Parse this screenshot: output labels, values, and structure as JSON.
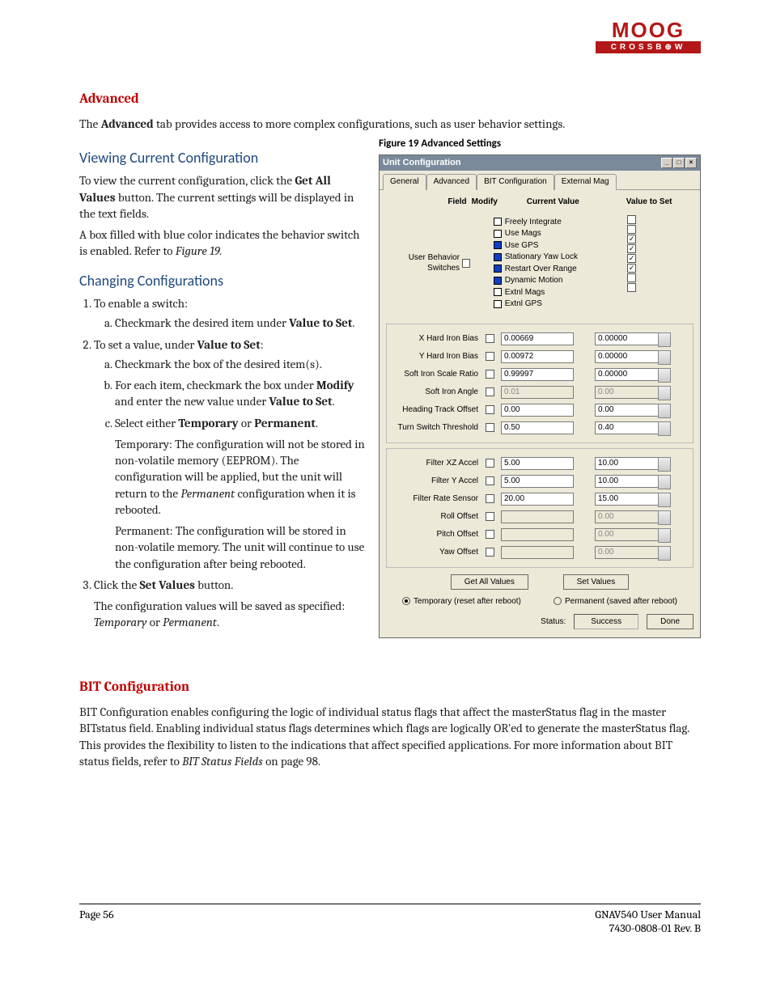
{
  "logo": {
    "top": "MOOG",
    "bottom": "CROSSB⊕W"
  },
  "sec1_title": "Advanced",
  "sec1_intro_a": "The ",
  "sec1_intro_b": "Advanced",
  "sec1_intro_c": " tab provides access to more complex configurations, such as user behavior settings.",
  "sec2_title": "Viewing Current Configuration",
  "sec2_p1_a": "To view the current configuration, click the ",
  "sec2_p1_b": "Get All Values",
  "sec2_p1_c": " button.  The current settings will be displayed in the text fields.",
  "sec2_p2_a": "A box filled with blue color indicates the behavior switch is enabled. Refer to ",
  "sec2_p2_b": "Figure 19.",
  "sec3_title": "Changing Configurations",
  "sec3_li1": "To enable a switch:",
  "sec3_li1a_a": "Checkmark the desired item under ",
  "sec3_li1a_b": "Value to Set",
  "sec3_li1a_c": ".",
  "sec3_li2_a": "To set a value, under ",
  "sec3_li2_b": "Value to Set",
  "sec3_li2_c": ":",
  "sec3_li2a": "Checkmark the box of the desired item(s).",
  "sec3_li2b_a": "For each item, checkmark the box under ",
  "sec3_li2b_b": "Modify",
  "sec3_li2b_c": " and enter the new value under ",
  "sec3_li2b_d": "Value to Set",
  "sec3_li2b_e": ".",
  "sec3_li2c_a": "Select either ",
  "sec3_li2c_b": "Temporary",
  "sec3_li2c_c": " or ",
  "sec3_li2c_d": "Permanent",
  "sec3_li2c_e": ".",
  "sec3_temp_a": "Temporary: The configuration will not be stored in non-volatile memory (EEPROM). The configuration will be applied, but the unit will return to the ",
  "sec3_temp_b": "Permanent",
  "sec3_temp_c": " configuration when it is rebooted.",
  "sec3_perm": "Permanent: The configuration will be stored in non-volatile memory. The unit will continue to use the configuration after being rebooted.",
  "sec3_li3_a": "Click the ",
  "sec3_li3_b": "Set Values",
  "sec3_li3_c": " button.",
  "sec3_li3_p_a": "The configuration values will be saved as specified: ",
  "sec3_li3_p_b": "Temporary",
  "sec3_li3_p_c": " or ",
  "sec3_li3_p_d": "Permanent",
  "sec3_li3_p_e": ".",
  "fig_caption": "Figure 19  Advanced Settings",
  "dlg": {
    "title": "Unit Configuration",
    "tabs": {
      "t1": "General",
      "t2": "Advanced",
      "t3": "BIT Configuration",
      "t4": "External Mag"
    },
    "hdr_field": "Field",
    "hdr_modify": "Modify",
    "hdr_current": "Current Value",
    "hdr_vts": "Value to Set",
    "ubs_label": "User Behavior Switches",
    "switches": [
      {
        "name": "Freely Integrate",
        "color": "#ffffff",
        "vts_checked": false
      },
      {
        "name": "Use Mags",
        "color": "#ffffff",
        "vts_checked": false
      },
      {
        "name": "Use GPS",
        "color": "#1040c0",
        "vts_checked": true
      },
      {
        "name": "Stationary Yaw Lock",
        "color": "#1040c0",
        "vts_checked": true
      },
      {
        "name": "Restart Over Range",
        "color": "#1040c0",
        "vts_checked": true
      },
      {
        "name": "Dynamic Motion",
        "color": "#1040c0",
        "vts_checked": true
      },
      {
        "name": "Extnl Mags",
        "color": "#ffffff",
        "vts_checked": false
      },
      {
        "name": "Extnl GPS",
        "color": "#ffffff",
        "vts_checked": false
      }
    ],
    "rows_g1": [
      {
        "label": "X Hard Iron Bias",
        "cur": "0.00669",
        "set": "0.00000",
        "dis": false
      },
      {
        "label": "Y Hard Iron Bias",
        "cur": "0.00972",
        "set": "0.00000",
        "dis": false
      },
      {
        "label": "Soft Iron Scale Ratio",
        "cur": "0.99997",
        "set": "0.00000",
        "dis": false
      },
      {
        "label": "Soft Iron Angle",
        "cur": "0.01",
        "set": "0.00",
        "dis": true
      },
      {
        "label": "Heading Track Offset",
        "cur": "0.00",
        "set": "0.00",
        "dis": false
      },
      {
        "label": "Turn Switch Threshold",
        "cur": "0.50",
        "set": "0.40",
        "dis": false
      }
    ],
    "rows_g2": [
      {
        "label": "Filter XZ Accel",
        "cur": "5.00",
        "set": "10.00",
        "dis": false
      },
      {
        "label": "Filter Y Accel",
        "cur": "5.00",
        "set": "10.00",
        "dis": false
      },
      {
        "label": "Filter Rate Sensor",
        "cur": "20.00",
        "set": "15.00",
        "dis": false
      },
      {
        "label": "Roll Offset",
        "cur": "",
        "set": "0.00",
        "dis": true
      },
      {
        "label": "Pitch Offset",
        "cur": "",
        "set": "0.00",
        "dis": true
      },
      {
        "label": "Yaw Offset",
        "cur": "",
        "set": "0.00",
        "dis": true
      }
    ],
    "btn_get": "Get All Values",
    "btn_set": "Set Values",
    "radio_temp": "Temporary (reset after reboot)",
    "radio_perm": "Permanent (saved after reboot)",
    "status_label": "Status:",
    "status_value": "Success",
    "btn_done": "Done"
  },
  "sec4_title": "BIT Configuration",
  "sec4_p_a": "BIT Configuration enables configuring the logic of individual status flags that affect the masterStatus flag in the master BITstatus field. Enabling individual status flags determines which flags are logically OR'ed to generate the masterStatus flag.  This provides the flexibility to listen to the indications that affect specified applications.  For more information about BIT status fields, refer to ",
  "sec4_p_b": "BIT Status Fields",
  "sec4_p_c": " on page 98.",
  "footer": {
    "page": "Page 56",
    "line1": "GNAV540 User Manual",
    "line2": "7430-0808-01 Rev. B"
  }
}
